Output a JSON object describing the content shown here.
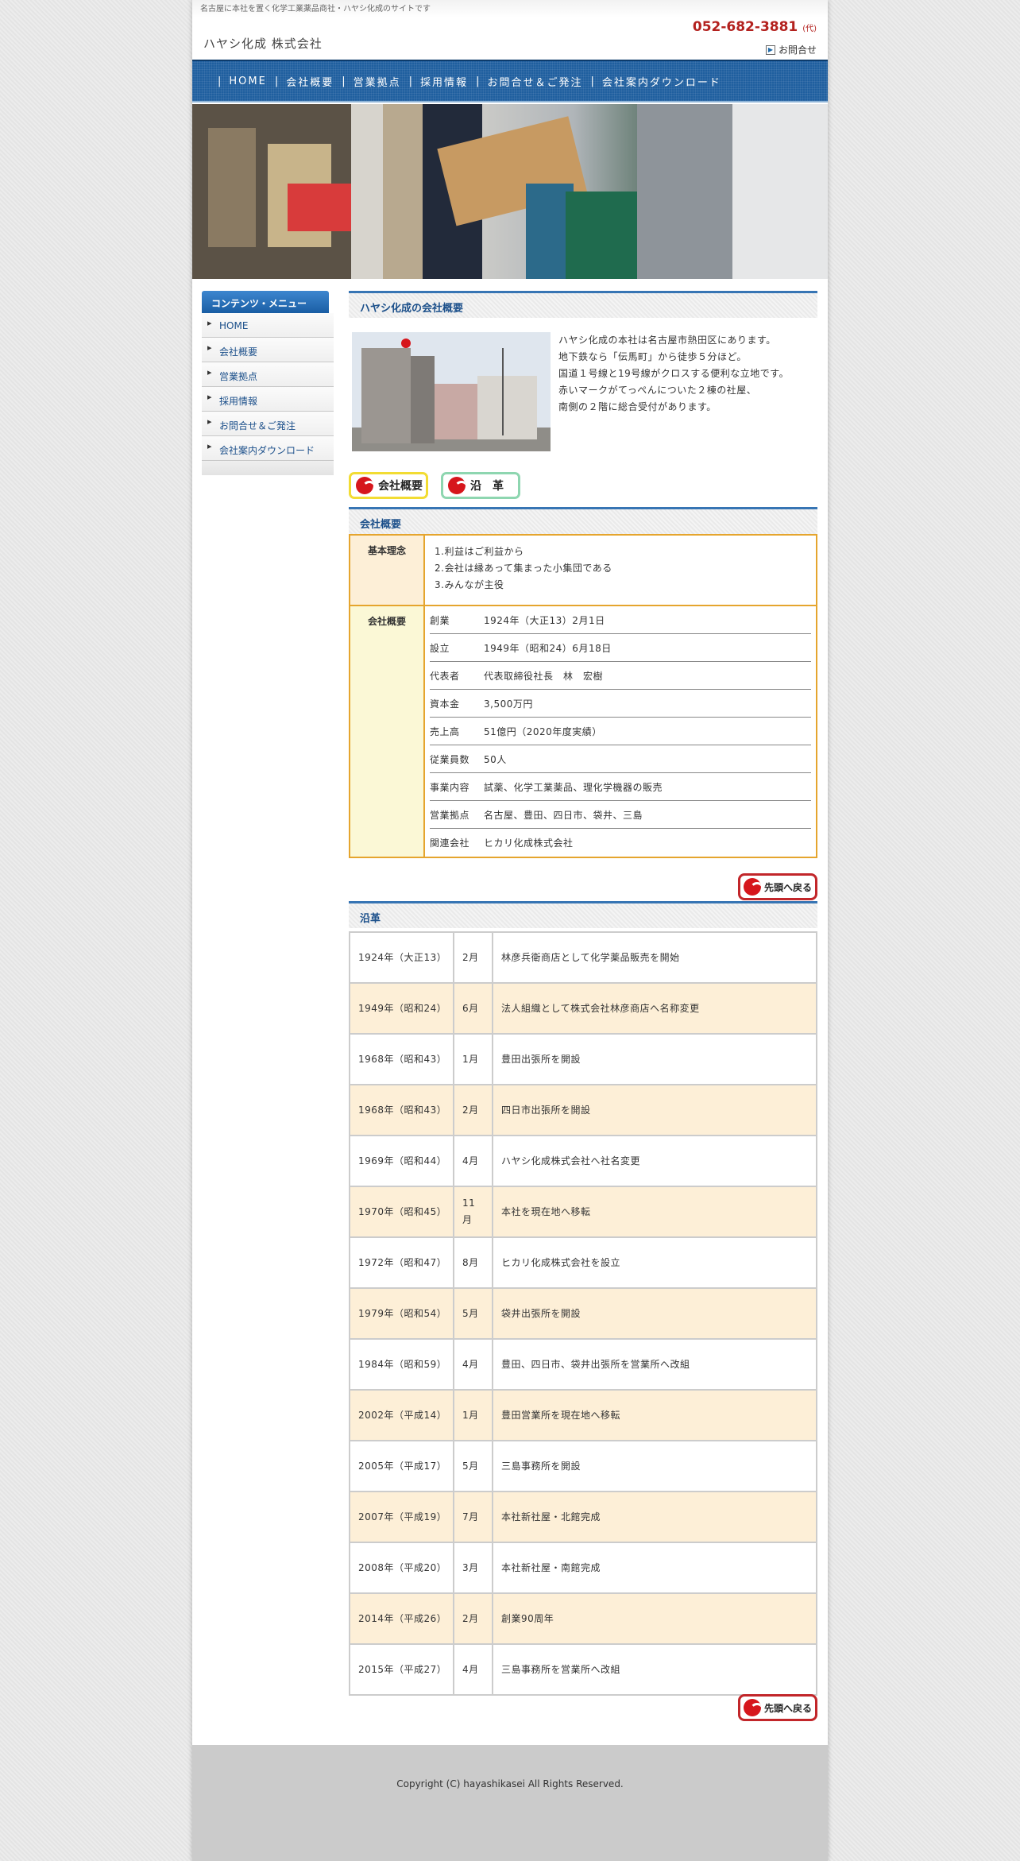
{
  "header": {
    "tagline": "名古屋に本社を置く化学工業薬品商社・ハヤシ化成のサイトです",
    "site_title": "ハヤシ化成 株式会社",
    "phone": "052-682-3881",
    "phone_suffix": "(代)",
    "contact_label": "お問合せ"
  },
  "nav": [
    "HOME",
    "会社概要",
    "営業拠点",
    "採用情報",
    "お問合せ＆ご発注",
    "会社案内ダウンロード"
  ],
  "sidebar": {
    "heading": "コンテンツ・メニュー",
    "items": [
      "HOME",
      "会社概要",
      "営業拠点",
      "採用情報",
      "お問合せ＆ご発注",
      "会社案内ダウンロード"
    ]
  },
  "intro": {
    "heading": "ハヤシ化成の会社概要",
    "lines": [
      "ハヤシ化成の本社は名古屋市熱田区にあります。",
      "地下鉄なら「伝馬町」から徒歩５分ほど。",
      "国道１号線と19号線がクロスする便利な立地です。",
      "赤いマークがてっぺんについた２棟の社屋、",
      "南側の２階に総合受付があります。"
    ]
  },
  "tabs": {
    "company": "会社概要",
    "history": "沿　革"
  },
  "company": {
    "heading": "会社概要",
    "philosophy_label": "基本理念",
    "philosophy": [
      "1.利益はご利益から",
      "2.会社は縁あって集まった小集団である",
      "3.みんなが主役"
    ],
    "overview_label": "会社概要",
    "overview": [
      {
        "k": "創業",
        "v": "1924年（大正13）2月1日"
      },
      {
        "k": "設立",
        "v": "1949年（昭和24）6月18日"
      },
      {
        "k": "代表者",
        "v": "代表取締役社長　林　宏樹"
      },
      {
        "k": "資本金",
        "v": "3,500万円"
      },
      {
        "k": "売上高",
        "v": "51億円（2020年度実績）"
      },
      {
        "k": "従業員数",
        "v": "50人"
      },
      {
        "k": "事業内容",
        "v": "試薬、化学工業薬品、理化学機器の販売"
      },
      {
        "k": "営業拠点",
        "v": "名古屋、豊田、四日市、袋井、三島"
      },
      {
        "k": "関連会社",
        "v": "ヒカリ化成株式会社"
      }
    ]
  },
  "back_to_top": "先頭へ戻る",
  "history": {
    "heading": "沿革",
    "rows": [
      {
        "y": "1924年（大正13）",
        "m": "2月",
        "e": "林彦兵衛商店として化学薬品販売を開始"
      },
      {
        "y": "1949年（昭和24）",
        "m": "6月",
        "e": "法人組織として株式会社林彦商店へ名称変更"
      },
      {
        "y": "1968年（昭和43）",
        "m": "1月",
        "e": "豊田出張所を開設"
      },
      {
        "y": "1968年（昭和43）",
        "m": "2月",
        "e": "四日市出張所を開設"
      },
      {
        "y": "1969年（昭和44）",
        "m": "4月",
        "e": "ハヤシ化成株式会社へ社名変更"
      },
      {
        "y": "1970年（昭和45）",
        "m": "11月",
        "e": "本社を現在地へ移転"
      },
      {
        "y": "1972年（昭和47）",
        "m": "8月",
        "e": "ヒカリ化成株式会社を設立"
      },
      {
        "y": "1979年（昭和54）",
        "m": "5月",
        "e": "袋井出張所を開設"
      },
      {
        "y": "1984年（昭和59）",
        "m": "4月",
        "e": "豊田、四日市、袋井出張所を営業所へ改組"
      },
      {
        "y": "2002年（平成14）",
        "m": "1月",
        "e": "豊田営業所を現在地へ移転"
      },
      {
        "y": "2005年（平成17）",
        "m": "5月",
        "e": "三島事務所を開設"
      },
      {
        "y": "2007年（平成19）",
        "m": "7月",
        "e": "本社新社屋・北館完成"
      },
      {
        "y": "2008年（平成20）",
        "m": "3月",
        "e": "本社新社屋・南館完成"
      },
      {
        "y": "2014年（平成26）",
        "m": "2月",
        "e": "創業90周年"
      },
      {
        "y": "2015年（平成27）",
        "m": "4月",
        "e": "三島事務所を営業所へ改組"
      }
    ]
  },
  "footer": {
    "copyright": "Copyright (C) hayashikasei All Rights Reserved."
  }
}
